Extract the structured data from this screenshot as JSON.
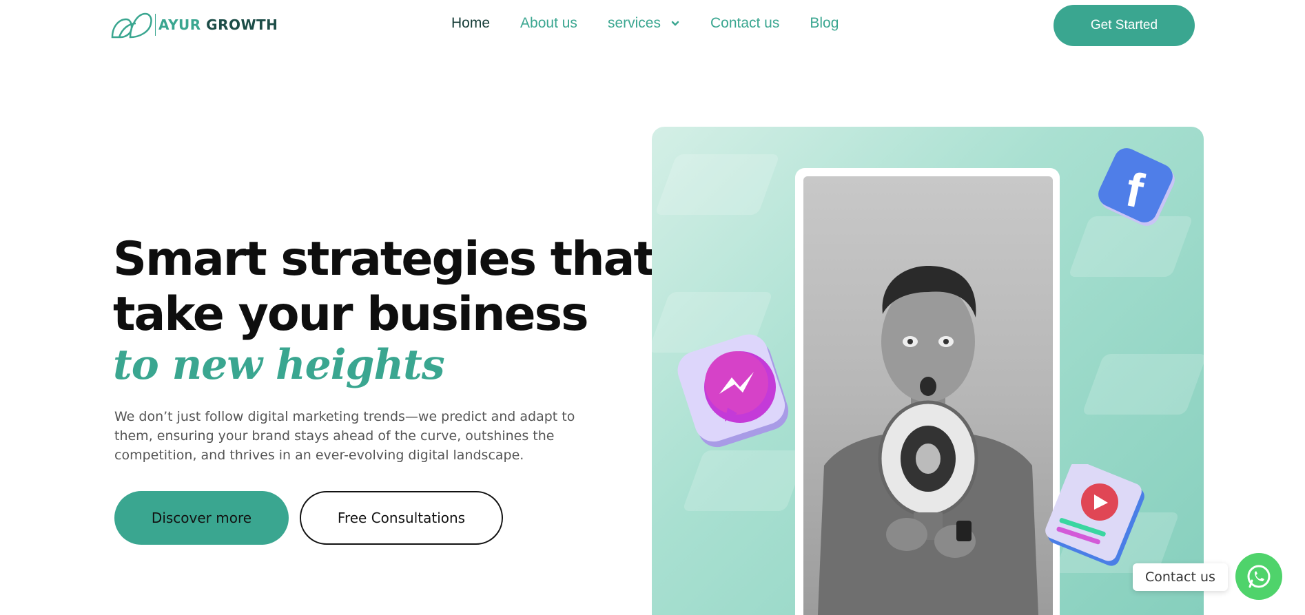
{
  "header": {
    "logo": {
      "part1": "AYUR",
      "part2": "GROWTH"
    },
    "nav": [
      {
        "label": "Home"
      },
      {
        "label": "About us"
      },
      {
        "label": "services"
      },
      {
        "label": "Contact us"
      },
      {
        "label": "Blog"
      }
    ],
    "cta_label": "Get Started"
  },
  "hero": {
    "title_line1": "Smart strategies that",
    "title_line2": "take your business",
    "title_accent": "to new heights",
    "description": "We don’t just follow digital marketing trends—we predict and adapt to them, ensuring your brand stays ahead of the curve, outshines the competition, and thrives in an ever-evolving digital landscape.",
    "primary_button": "Discover more",
    "secondary_button": "Free Consultations"
  },
  "floating_icons": [
    "facebook-icon",
    "messenger-icon",
    "video-play-icon",
    "megaphone-icon"
  ],
  "widget": {
    "contact_label": "Contact us",
    "icon": "whatsapp-icon"
  },
  "colors": {
    "accent": "#3aa690",
    "dark_green": "#153c37",
    "whatsapp": "#4fd36b"
  }
}
